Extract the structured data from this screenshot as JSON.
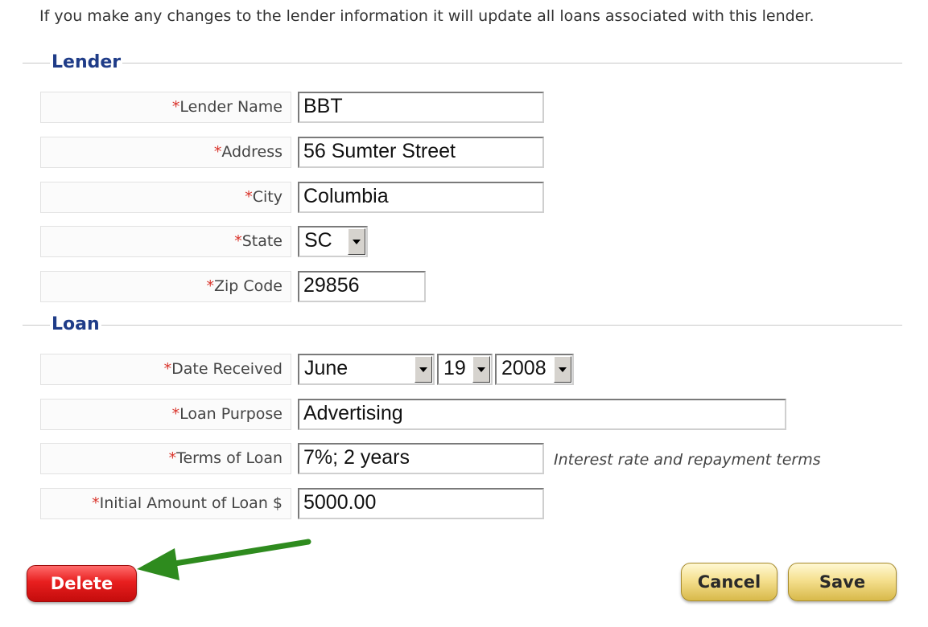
{
  "notice": "If you make any changes to the lender information it will update all loans associated with this lender.",
  "lender": {
    "legend": "Lender",
    "fields": {
      "lender_name": {
        "label": "Lender Name",
        "value": "BBT"
      },
      "address": {
        "label": "Address",
        "value": "56 Sumter Street"
      },
      "city": {
        "label": "City",
        "value": "Columbia"
      },
      "state": {
        "label": "State",
        "value": "SC"
      },
      "zip": {
        "label": "Zip Code",
        "value": "29856"
      }
    }
  },
  "loan": {
    "legend": "Loan",
    "fields": {
      "date_received": {
        "label": "Date Received",
        "month": "June",
        "day": "19",
        "year": "2008"
      },
      "purpose": {
        "label": "Loan Purpose",
        "value": "Advertising"
      },
      "terms": {
        "label": "Terms of Loan",
        "value": "7%; 2 years",
        "hint": "Interest rate and repayment terms"
      },
      "amount": {
        "label": "Initial Amount of Loan $",
        "value": "5000.00"
      }
    }
  },
  "required_marker": "*",
  "buttons": {
    "delete": "Delete",
    "cancel": "Cancel",
    "save": "Save"
  },
  "colors": {
    "legend": "#1f3c88",
    "required": "#d9342b",
    "delete_button": "#e81f1f",
    "gold_button": "#f5e08f",
    "annotation_arrow": "#2e8b1e"
  },
  "annotation": {
    "icon": "green-arrow-icon"
  }
}
